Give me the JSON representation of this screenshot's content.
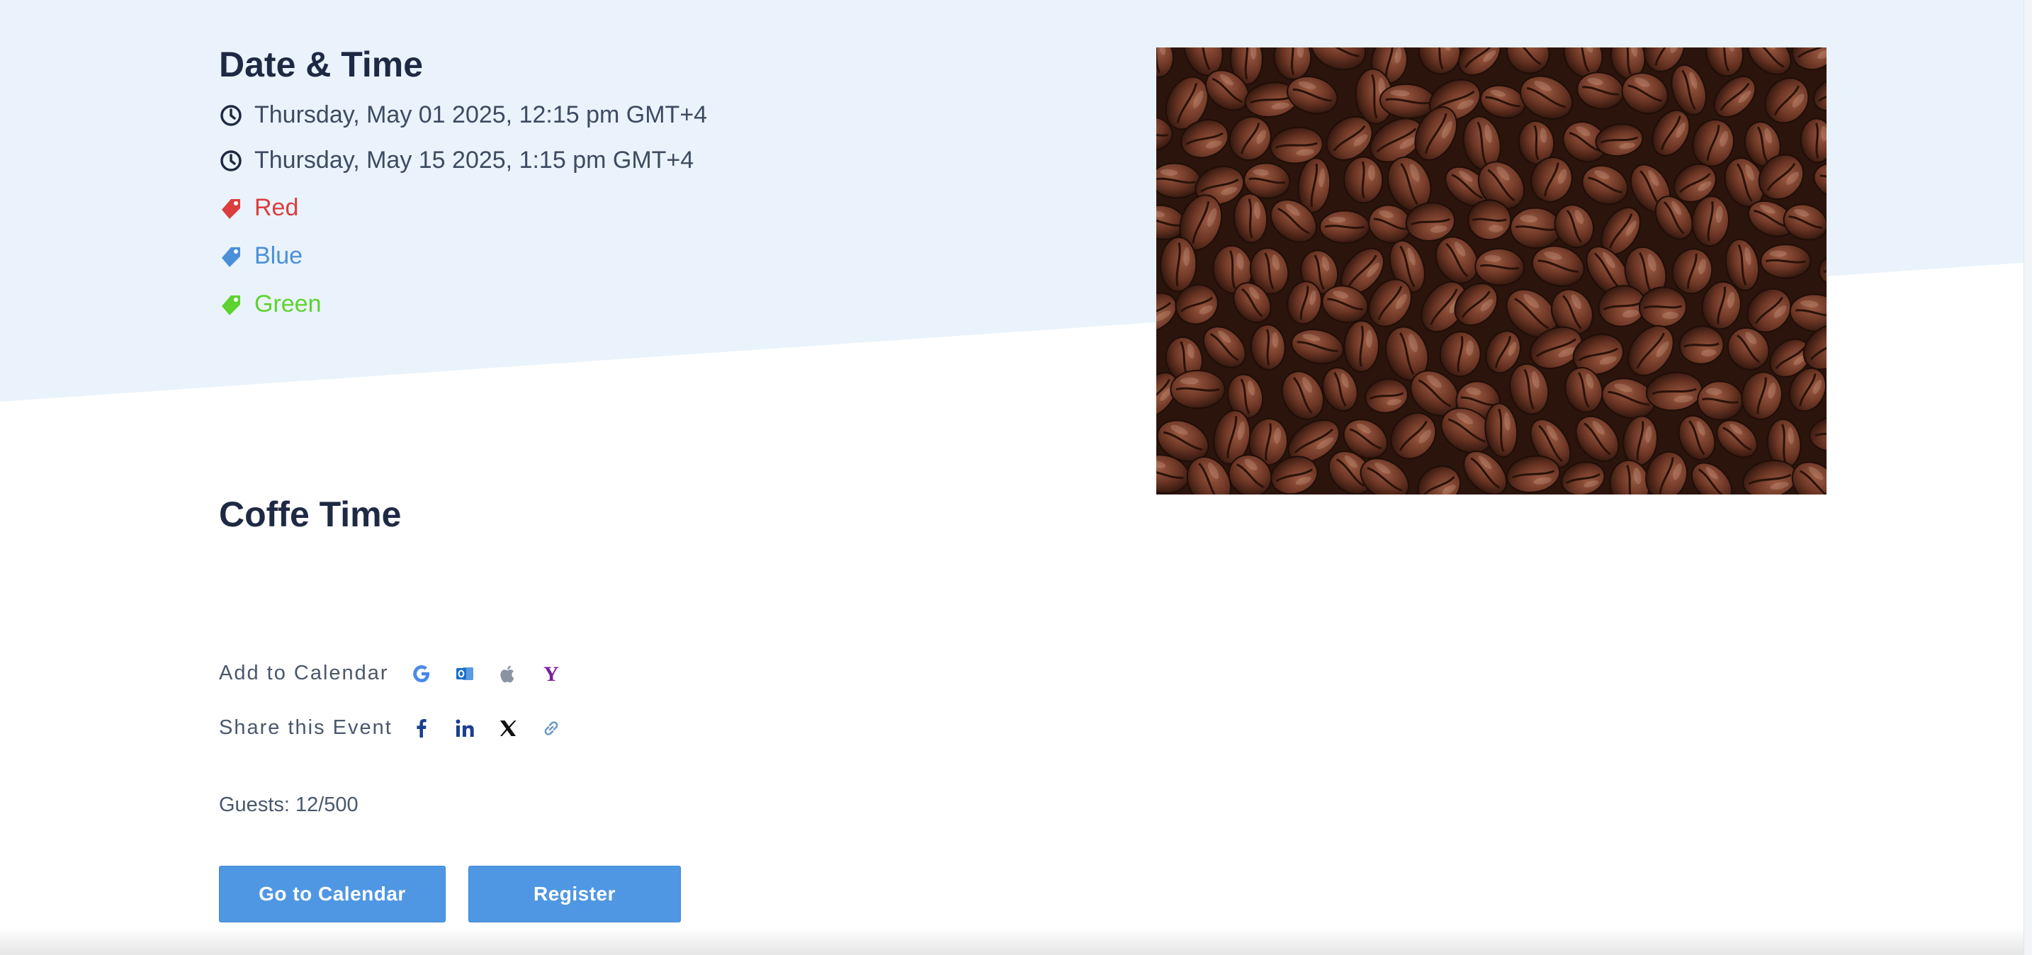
{
  "date_time": {
    "heading": "Date & Time",
    "start": "Thursday, May 01 2025, 12:15 pm GMT+4",
    "end": "Thursday, May 15 2025, 1:15 pm GMT+4",
    "tags": [
      {
        "label": "Red",
        "color": "#dc3d3d"
      },
      {
        "label": "Blue",
        "color": "#4a90d9"
      },
      {
        "label": "Green",
        "color": "#5ed32f"
      }
    ]
  },
  "event": {
    "title": "Coffe Time",
    "image_icon": "coffee-beans-photo"
  },
  "add_to_calendar": {
    "label": "Add to Calendar",
    "providers": [
      "google-icon",
      "outlook-icon",
      "apple-icon",
      "yahoo-icon"
    ]
  },
  "share": {
    "label": "Share this Event",
    "channels": [
      "facebook-icon",
      "linkedin-icon",
      "x-icon",
      "link-icon"
    ]
  },
  "guests": {
    "text": "Guests: 12/500"
  },
  "buttons": {
    "go_to_calendar": "Go to Calendar",
    "register": "Register"
  },
  "colors": {
    "band": "#eaf3fb",
    "button": "#4f97e3",
    "heading": "#1e2a44"
  }
}
